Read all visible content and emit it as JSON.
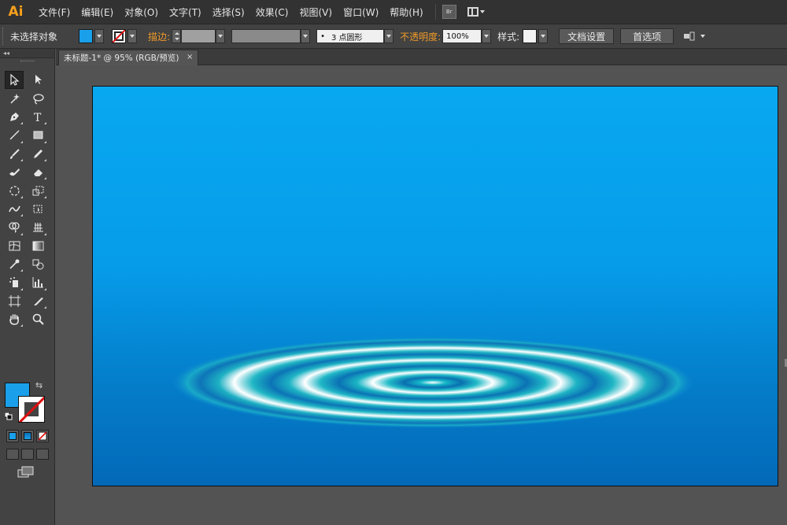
{
  "app": {
    "logo": "Ai"
  },
  "menu": {
    "items": [
      "文件(F)",
      "编辑(E)",
      "对象(O)",
      "文字(T)",
      "选择(S)",
      "效果(C)",
      "视图(V)",
      "窗口(W)",
      "帮助(H)"
    ],
    "bridge_label": "Br"
  },
  "control": {
    "selection_status": "未选择对象",
    "fill_color": "#1aa0ea",
    "stroke_label": "描边:",
    "brush_size_label": "3 点圆形",
    "opacity_label": "不透明度:",
    "opacity_value": "100%",
    "style_label": "样式:",
    "doc_setup_button": "文档设置",
    "preferences_button": "首选项"
  },
  "document": {
    "tab_title": "未标题-1* @ 95% (RGB/预览)",
    "close_glyph": "×"
  },
  "colors": {
    "accent_orange": "#f09a28",
    "artboard_top": "#08a8f0",
    "artboard_bottom": "#0369b8"
  },
  "tools": {
    "names": [
      "selection-tool",
      "direct-selection-tool",
      "magic-wand-tool",
      "lasso-tool",
      "pen-tool",
      "type-tool",
      "line-segment-tool",
      "rectangle-tool",
      "paintbrush-tool",
      "pencil-tool",
      "blob-brush-tool",
      "eraser-tool",
      "rotate-tool",
      "scale-tool",
      "warp-tool",
      "free-transform-tool",
      "shape-builder-tool",
      "perspective-grid-tool",
      "mesh-tool",
      "gradient-tool",
      "eyedropper-tool",
      "blend-tool",
      "symbol-sprayer-tool",
      "column-graph-tool",
      "artboard-tool",
      "slice-tool",
      "hand-tool",
      "zoom-tool"
    ]
  }
}
